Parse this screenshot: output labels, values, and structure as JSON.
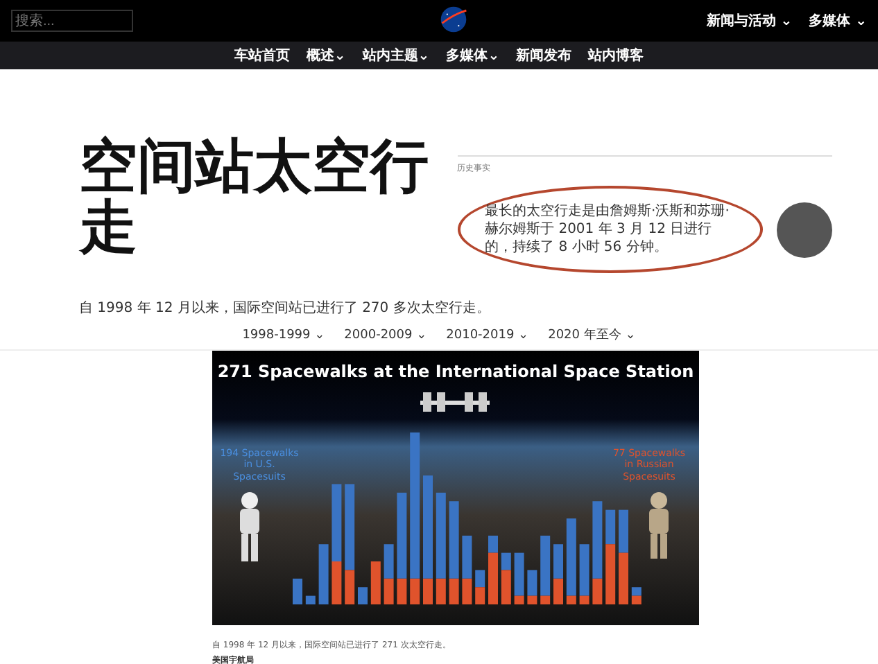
{
  "header": {
    "search": {
      "placeholder": "搜索..."
    },
    "menu": [
      {
        "label": "新闻与活动",
        "caret": "⌄"
      },
      {
        "label": "多媒体",
        "caret": "⌄"
      }
    ]
  },
  "nav": [
    {
      "label": "车站首页"
    },
    {
      "label": "概述",
      "caret": "⌄"
    },
    {
      "label": "站内主题",
      "caret": "⌄"
    },
    {
      "label": "多媒体",
      "caret": "⌄"
    },
    {
      "label": "新闻发布"
    },
    {
      "label": "站内博客"
    }
  ],
  "title": "空间站太空行走",
  "fact": {
    "label": "历史事实",
    "text": "最长的太空行走是由詹姆斯·沃斯和苏珊·赫尔姆斯于 2001 年 3 月 12 日进行的，持续了 8 小时 56 分钟。",
    "highlighted": true
  },
  "intro": "自 1998 年 12 月以来，国际空间站已进行了 270 多次太空行走。",
  "filters": [
    {
      "label": "1998-1999",
      "caret": "⌄"
    },
    {
      "label": "2000-2009",
      "caret": "⌄"
    },
    {
      "label": "2010-2019",
      "caret": "⌄"
    },
    {
      "label": "2020 年至今",
      "caret": "⌄"
    }
  ],
  "figure": {
    "title": "271 Spacewalks at the International Space Station",
    "left_label": "194 Spacewalks in U.S. Spacesuits",
    "right_label": "77 Spacewalks in Russian Spacesuits",
    "caption": "自 1998 年 12 月以来，国际空间站已进行了 271 次太空行走。",
    "credit": "美国宇航局"
  }
}
